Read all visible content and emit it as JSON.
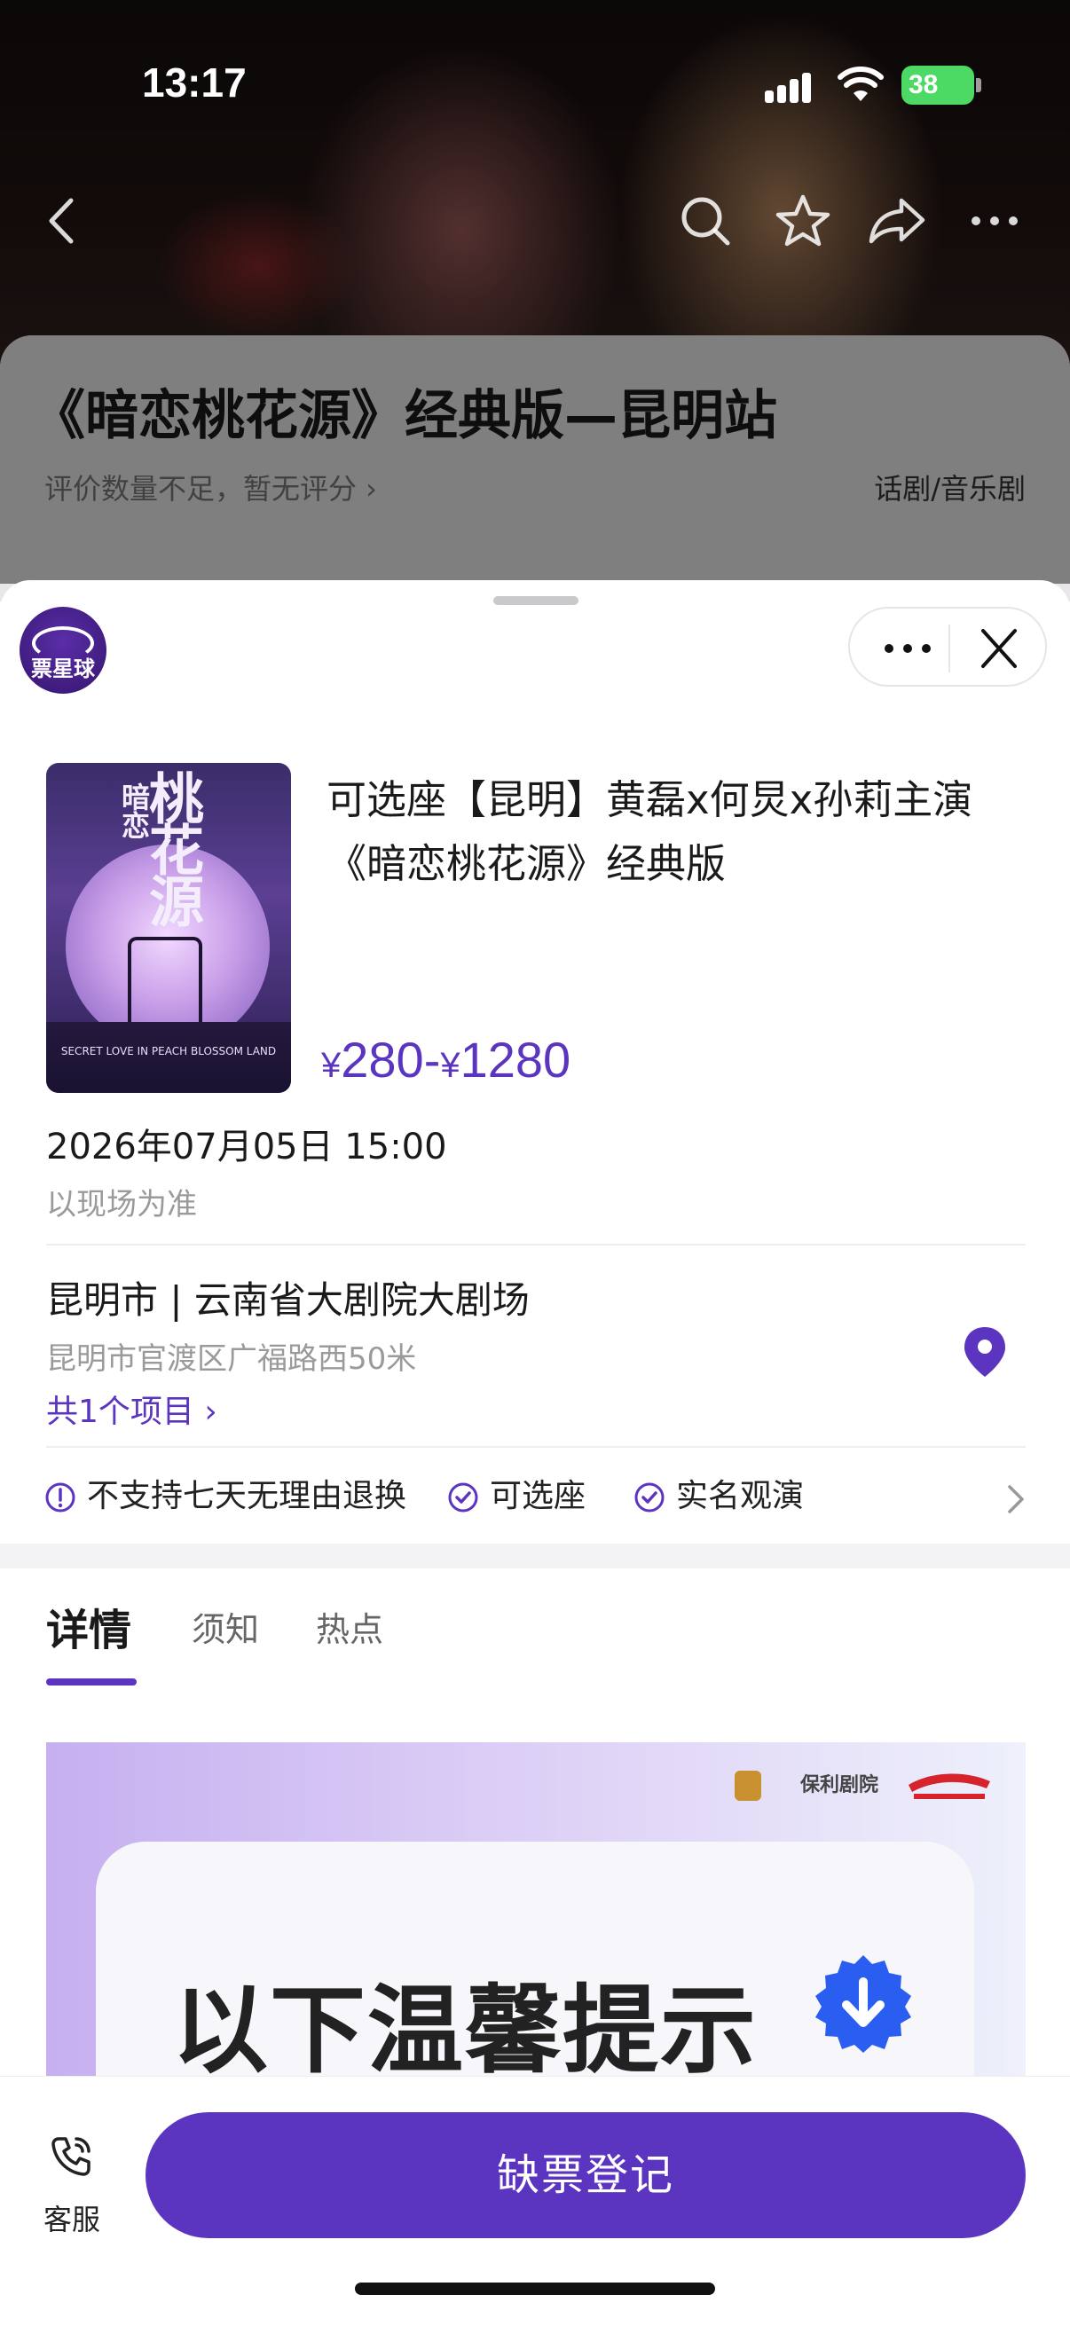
{
  "status_bar": {
    "time": "13:17",
    "battery": "38"
  },
  "background_page": {
    "title": "《暗恋桃花源》经典版—昆明站",
    "rating": "评价数量不足，暂无评分 ›",
    "genre": "话剧/音乐剧"
  },
  "nav_icons": [
    "back-icon",
    "search-icon",
    "star-icon",
    "share-icon",
    "more-icon"
  ],
  "sheet": {
    "app_logo": "票星球",
    "poster": {
      "title": "桃花源",
      "subtitle": "暗恋",
      "english": "SECRET LOVE IN PEACH BLOSSOM LAND"
    },
    "show_title": "可选座【昆明】黄磊x何炅x孙莉主演《暗恋桃花源》经典版",
    "price": {
      "currency": "¥",
      "low": "280",
      "sep": "-",
      "high": "1280"
    },
    "datetime": "2026年07月05日 15:00",
    "date_note": "以现场为准",
    "venue": "昆明市 | 云南省大剧院大剧场",
    "address": "昆明市官渡区广福路西50米",
    "items_link": "共1个项目 ›",
    "tags": [
      {
        "label": "不支持七天无理由退换",
        "icon": "info-circle-icon"
      },
      {
        "label": "可选座",
        "icon": "check-circle-icon"
      },
      {
        "label": "实名观演",
        "icon": "check-circle-icon"
      }
    ],
    "tabs": [
      {
        "label": "详情",
        "active": true
      },
      {
        "label": "须知",
        "active": false
      },
      {
        "label": "热点",
        "active": false
      }
    ],
    "banner": {
      "logo_left": "保利剧院",
      "headline": "以下温馨提示"
    }
  },
  "bottom_bar": {
    "service_label": "客服",
    "cta_label": "缺票登记"
  },
  "colors": {
    "accent": "#5b34c0",
    "banner_gradient_start": "#c6b0f0",
    "badge": "#2a5ef0"
  }
}
